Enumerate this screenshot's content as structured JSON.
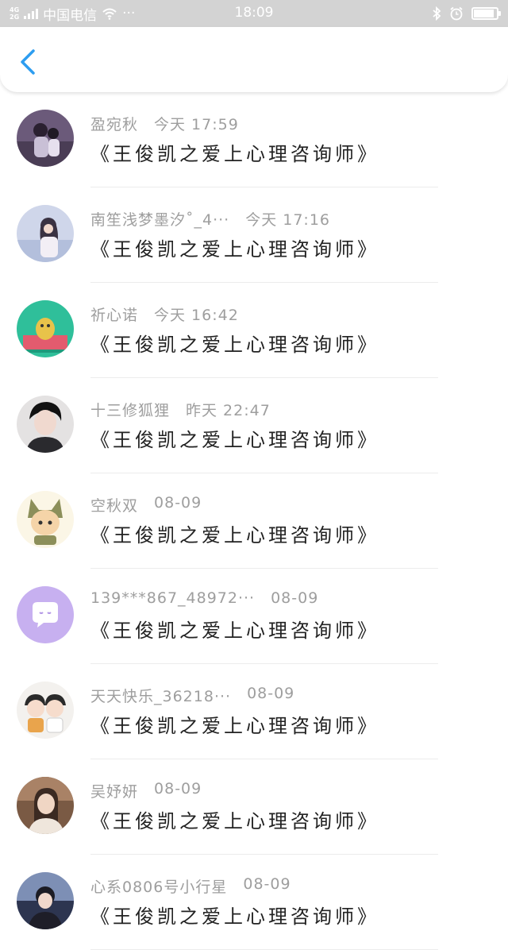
{
  "status_bar": {
    "network_top": "4G",
    "network_bottom": "2G",
    "carrier": "中国电信",
    "dots": "···",
    "time": "18:09",
    "battery_level": 0.95
  },
  "nav": {
    "back_icon": "chevron-left-icon",
    "accent": "#2d9df0"
  },
  "items": [
    {
      "name": "盈宛秋",
      "time": "今天 17:59",
      "message": "《王俊凯之爱上心理咨询师》"
    },
    {
      "name": "南笙浅梦墨汐˚_4···",
      "time": "今天 17:16",
      "message": "《王俊凯之爱上心理咨询师》"
    },
    {
      "name": "祈心诺",
      "time": "今天 16:42",
      "message": "《王俊凯之爱上心理咨询师》"
    },
    {
      "name": "十三修狐狸",
      "time": "昨天 22:47",
      "message": "《王俊凯之爱上心理咨询师》"
    },
    {
      "name": "空秋双",
      "time": "08-09",
      "message": "《王俊凯之爱上心理咨询师》"
    },
    {
      "name": "139***867_48972···",
      "time": "08-09",
      "message": "《王俊凯之爱上心理咨询师》"
    },
    {
      "name": "天天快乐_36218···",
      "time": "08-09",
      "message": "《王俊凯之爱上心理咨询师》"
    },
    {
      "name": "吴妤妍",
      "time": "08-09",
      "message": "《王俊凯之爱上心理咨询师》"
    },
    {
      "name": "心系0806号小行星",
      "time": "08-09",
      "message": "《王俊凯之爱上心理咨询师》"
    }
  ]
}
